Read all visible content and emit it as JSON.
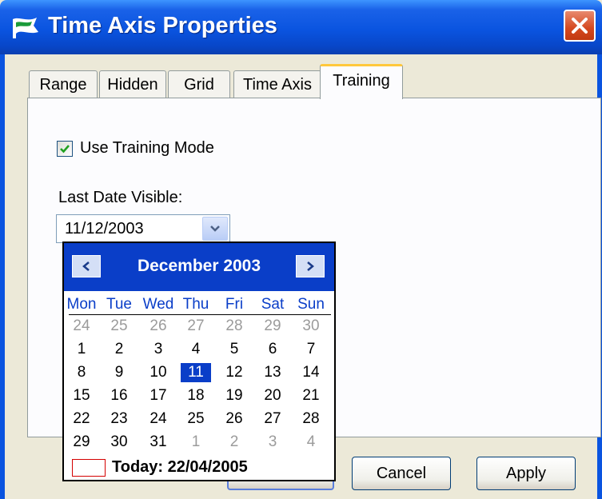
{
  "window": {
    "title": "Time Axis Properties"
  },
  "tabs": [
    {
      "label": "Range"
    },
    {
      "label": "Hidden"
    },
    {
      "label": "Grid"
    },
    {
      "label": "Time Axis"
    },
    {
      "label": "Training",
      "active": true
    }
  ],
  "training": {
    "use_training_mode_label": "Use Training Mode",
    "use_training_mode_checked": true,
    "last_date_label": "Last Date Visible:",
    "last_date_value": "11/12/2003"
  },
  "calendar": {
    "month_title": "December 2003",
    "weekdays": [
      "Mon",
      "Tue",
      "Wed",
      "Thu",
      "Fri",
      "Sat",
      "Sun"
    ],
    "weeks": [
      [
        "24",
        "25",
        "26",
        "27",
        "28",
        "29",
        "30"
      ],
      [
        "1",
        "2",
        "3",
        "4",
        "5",
        "6",
        "7"
      ],
      [
        "8",
        "9",
        "10",
        "11",
        "12",
        "13",
        "14"
      ],
      [
        "15",
        "16",
        "17",
        "18",
        "19",
        "20",
        "21"
      ],
      [
        "22",
        "23",
        "24",
        "25",
        "26",
        "27",
        "28"
      ],
      [
        "29",
        "30",
        "31",
        "1",
        "2",
        "3",
        "4"
      ]
    ],
    "selected_day": "11",
    "today_label": "Today: 22/04/2005"
  },
  "buttons": {
    "cancel": "Cancel",
    "apply": "Apply"
  },
  "icons": [
    "app-icon",
    "close-icon",
    "check-icon",
    "dropdown-arrow-icon",
    "prev-month-icon",
    "next-month-icon"
  ],
  "colors": {
    "titlebar": "#0a54e0",
    "calendar_header": "#0a3ec8",
    "tab_highlight": "#ffc83c",
    "today_marker": "#d40000"
  }
}
